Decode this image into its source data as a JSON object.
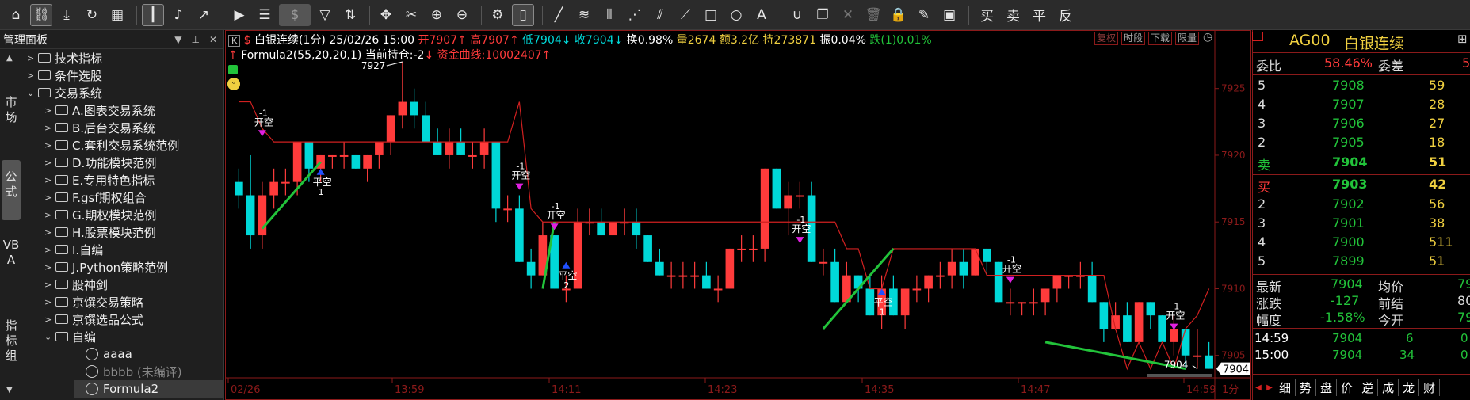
{
  "toolbar": {
    "trade_buy": "买",
    "trade_sell": "卖",
    "trade_flat": "平",
    "trade_reverse": "反",
    "icons": [
      "home-icon",
      "link-icon",
      "download-icon",
      "refresh-icon",
      "grid-icon",
      "candle-icon",
      "bell-icon",
      "chart-icon",
      "play-icon",
      "doc-icon",
      "money-icon",
      "filter-icon",
      "sort-icon",
      "move-icon",
      "cross-icon",
      "zoom-in-icon",
      "zoom-out-icon",
      "gear-icon",
      "mouse-icon",
      "line-icon",
      "fib-icon",
      "channel-icon",
      "fan-icon",
      "parallel-icon",
      "gann-icon",
      "rect-icon",
      "circle-icon",
      "text-icon",
      "magnet-icon",
      "copy-icon",
      "delete-icon",
      "trash-icon",
      "lock-icon",
      "pen-icon",
      "save-icon"
    ]
  },
  "sidebar": {
    "title": "管理面板",
    "vtabs": [
      "市场",
      "公式",
      "VBA",
      "指标组"
    ],
    "tree": [
      {
        "label": "技术指标",
        "level": 1,
        "type": "folder",
        "arrow": "›"
      },
      {
        "label": "条件选股",
        "level": 1,
        "type": "folder",
        "arrow": "›"
      },
      {
        "label": "交易系统",
        "level": 1,
        "type": "folder",
        "arrow": "⌄"
      },
      {
        "label": "A.图表交易系统",
        "level": 2,
        "type": "folder",
        "arrow": "›"
      },
      {
        "label": "B.后台交易系统",
        "level": 2,
        "type": "folder",
        "arrow": "›"
      },
      {
        "label": "C.套利交易系统范例",
        "level": 2,
        "type": "folder",
        "arrow": "›"
      },
      {
        "label": "D.功能模块范例",
        "level": 2,
        "type": "folder",
        "arrow": "›"
      },
      {
        "label": "E.专用特色指标",
        "level": 2,
        "type": "folder",
        "arrow": "›"
      },
      {
        "label": "F.gsf期权组合",
        "level": 2,
        "type": "folder",
        "arrow": "›"
      },
      {
        "label": "G.期权模块范例",
        "level": 2,
        "type": "folder",
        "arrow": "›"
      },
      {
        "label": "H.股票模块范例",
        "level": 2,
        "type": "folder",
        "arrow": "›"
      },
      {
        "label": "I.自编",
        "level": 2,
        "type": "folder",
        "arrow": "›"
      },
      {
        "label": "J.Python策略范例",
        "level": 2,
        "type": "folder",
        "arrow": "›"
      },
      {
        "label": "股神剑",
        "level": 2,
        "type": "folder",
        "arrow": "›"
      },
      {
        "label": "京馔交易策略",
        "level": 2,
        "type": "folder",
        "arrow": "›"
      },
      {
        "label": "京馔选品公式",
        "level": 2,
        "type": "folder",
        "arrow": "›"
      },
      {
        "label": "自编",
        "level": 2,
        "type": "folder",
        "arrow": "⌄"
      },
      {
        "label": "aaaa",
        "level": 3,
        "type": "formula",
        "arrow": ""
      },
      {
        "label": "bbbb (未编译)",
        "level": 3,
        "type": "formula",
        "arrow": "",
        "dim": true
      },
      {
        "label": "Formula2",
        "level": 3,
        "type": "formula",
        "arrow": "",
        "selected": true
      }
    ]
  },
  "chart": {
    "header": {
      "k_badge": "K",
      "s_badge": "$",
      "name": "白银连续(1分)",
      "datetime": "25/02/26 15:00",
      "open": "开7907",
      "high": "高7907",
      "low": "低7904",
      "close": "收7904",
      "turnover_rate": "换0.98%",
      "volume": "量2674",
      "amount": "额3.2亿",
      "open_interest": "持273871",
      "amplitude": "振0.04%",
      "change": "跌(1)0.01%",
      "btn_restore": "复权",
      "btn_time": "时段",
      "btn_download": "下载",
      "btn_limit": "限量"
    },
    "formula_line": {
      "name": "Formula2(55,20,20,1)",
      "position": "当前持仓:-2",
      "equity": "资金曲线:10002407"
    },
    "y_ticks": [
      "7925",
      "7920",
      "7915",
      "7910",
      "7905"
    ],
    "x_ticks": [
      "02/26",
      "13:59",
      "14:11",
      "14:23",
      "14:35",
      "14:47",
      "14:59"
    ],
    "period": "1分",
    "last_price_label": "7904",
    "high_label": "7927",
    "low_label": "7904",
    "signals": [
      {
        "n": "-1",
        "text": "开空"
      },
      {
        "n": "1",
        "text": "平空"
      },
      {
        "n": "-1",
        "text": "开空"
      },
      {
        "n": "-1",
        "text": "开空"
      },
      {
        "n": "2",
        "text": "平空"
      },
      {
        "n": "-1",
        "text": "开空"
      },
      {
        "n": "1",
        "text": "平空"
      },
      {
        "n": "-1",
        "text": "开空"
      },
      {
        "n": "-1",
        "text": "开空"
      }
    ]
  },
  "chart_data": {
    "type": "candlestick",
    "title": "白银连续(1分)",
    "ylim": [
      7903.5,
      7927
    ],
    "x_labels": [
      "02/26",
      "13:59",
      "14:11",
      "14:23",
      "14:35",
      "14:47",
      "14:59"
    ],
    "candles": [
      [
        7918,
        7919,
        7916,
        7917
      ],
      [
        7917,
        7920,
        7913,
        7914
      ],
      [
        7914,
        7918,
        7913,
        7917
      ],
      [
        7917,
        7919,
        7916,
        7918
      ],
      [
        7918,
        7919,
        7917,
        7918
      ],
      [
        7918,
        7921,
        7917,
        7921
      ],
      [
        7921,
        7921,
        7918,
        7919
      ],
      [
        7919,
        7920,
        7918,
        7920
      ],
      [
        7920,
        7920,
        7919,
        7920
      ],
      [
        7920,
        7921,
        7919,
        7920
      ],
      [
        7920,
        7920,
        7919,
        7919
      ],
      [
        7919,
        7920,
        7918,
        7920
      ],
      [
        7920,
        7921,
        7919,
        7921
      ],
      [
        7921,
        7923,
        7920,
        7923
      ],
      [
        7923,
        7927,
        7922,
        7924
      ],
      [
        7924,
        7925,
        7922,
        7923
      ],
      [
        7923,
        7924,
        7921,
        7921
      ],
      [
        7921,
        7922,
        7920,
        7920
      ],
      [
        7920,
        7922,
        7919,
        7921
      ],
      [
        7921,
        7922,
        7920,
        7920
      ],
      [
        7920,
        7921,
        7919,
        7920
      ],
      [
        7920,
        7922,
        7919,
        7921
      ],
      [
        7921,
        7921,
        7915,
        7916
      ],
      [
        7916,
        7917,
        7915,
        7916
      ],
      [
        7916,
        7917,
        7912,
        7912
      ],
      [
        7912,
        7913,
        7910,
        7911
      ],
      [
        7911,
        7915,
        7911,
        7914
      ],
      [
        7914,
        7914,
        7910,
        7910
      ],
      [
        7910,
        7911,
        7909,
        7910
      ],
      [
        7910,
        7916,
        7910,
        7915
      ],
      [
        7915,
        7916,
        7914,
        7915
      ],
      [
        7915,
        7916,
        7914,
        7914
      ],
      [
        7914,
        7915,
        7914,
        7915
      ],
      [
        7915,
        7916,
        7914,
        7915
      ],
      [
        7915,
        7916,
        7913,
        7914
      ],
      [
        7914,
        7914,
        7912,
        7912
      ],
      [
        7912,
        7913,
        7911,
        7911
      ],
      [
        7911,
        7912,
        7910,
        7911
      ],
      [
        7911,
        7912,
        7910,
        7911
      ],
      [
        7911,
        7912,
        7910,
        7911
      ],
      [
        7911,
        7912,
        7910,
        7910
      ],
      [
        7910,
        7911,
        7909,
        7910
      ],
      [
        7910,
        7913,
        7910,
        7913
      ],
      [
        7913,
        7914,
        7912,
        7913
      ],
      [
        7913,
        7914,
        7912,
        7913
      ],
      [
        7913,
        7919,
        7912,
        7919
      ],
      [
        7919,
        7919,
        7916,
        7916
      ],
      [
        7916,
        7918,
        7914,
        7917
      ],
      [
        7917,
        7918,
        7916,
        7917
      ],
      [
        7917,
        7918,
        7912,
        7912
      ],
      [
        7912,
        7913,
        7911,
        7912
      ],
      [
        7912,
        7913,
        7909,
        7909
      ],
      [
        7909,
        7912,
        7909,
        7911
      ],
      [
        7911,
        7911,
        7909,
        7910
      ],
      [
        7910,
        7911,
        7908,
        7908
      ],
      [
        7908,
        7911,
        7907,
        7910
      ],
      [
        7910,
        7911,
        7908,
        7908
      ],
      [
        7908,
        7910,
        7907,
        7910
      ],
      [
        7910,
        7911,
        7909,
        7910
      ],
      [
        7910,
        7911,
        7909,
        7911
      ],
      [
        7911,
        7912,
        7910,
        7911
      ],
      [
        7911,
        7913,
        7910,
        7912
      ],
      [
        7912,
        7913,
        7910,
        7911
      ],
      [
        7911,
        7913,
        7911,
        7913
      ],
      [
        7913,
        7913,
        7911,
        7912
      ],
      [
        7912,
        7912,
        7909,
        7909
      ],
      [
        7909,
        7910,
        7908,
        7909
      ],
      [
        7909,
        7909,
        7908,
        7909
      ],
      [
        7909,
        7910,
        7908,
        7909
      ],
      [
        7909,
        7910,
        7908,
        7910
      ],
      [
        7910,
        7911,
        7909,
        7911
      ],
      [
        7911,
        7911,
        7910,
        7911
      ],
      [
        7911,
        7912,
        7910,
        7911
      ],
      [
        7911,
        7912,
        7909,
        7909
      ],
      [
        7909,
        7909,
        7906,
        7907
      ],
      [
        7907,
        7909,
        7907,
        7908
      ],
      [
        7908,
        7909,
        7906,
        7906
      ],
      [
        7906,
        7909,
        7906,
        7909
      ],
      [
        7909,
        7909,
        7907,
        7908
      ],
      [
        7908,
        7908,
        7906,
        7906
      ],
      [
        7906,
        7908,
        7905,
        7907
      ],
      [
        7907,
        7907,
        7904,
        7905
      ],
      [
        7905,
        7907,
        7904,
        7905
      ],
      [
        7905,
        7906,
        7904,
        7904
      ]
    ]
  },
  "right_panel": {
    "code": "AG00",
    "name": "白银连续",
    "wb_label": "委比",
    "wb_value": "58.46%",
    "wc_label": "委差",
    "wc_value": "5",
    "asks": [
      {
        "level": "5",
        "price": "7908",
        "vol": "59"
      },
      {
        "level": "4",
        "price": "7907",
        "vol": "28"
      },
      {
        "level": "3",
        "price": "7906",
        "vol": "27"
      },
      {
        "level": "2",
        "price": "7905",
        "vol": "18"
      },
      {
        "level": "卖",
        "price": "7904",
        "vol": "51"
      }
    ],
    "bids": [
      {
        "level": "买",
        "price": "7903",
        "vol": "42"
      },
      {
        "level": "2",
        "price": "7902",
        "vol": "56"
      },
      {
        "level": "3",
        "price": "7901",
        "vol": "38"
      },
      {
        "level": "4",
        "price": "7900",
        "vol": "511"
      },
      {
        "level": "5",
        "price": "7899",
        "vol": "51"
      }
    ],
    "stats": [
      {
        "l1": "最新",
        "v1": "7904",
        "l2": "均价",
        "v2": "79"
      },
      {
        "l1": "涨跌",
        "v1": "-127",
        "l2": "前结",
        "v2": "80"
      },
      {
        "l1": "幅度",
        "v1": "-1.58%",
        "l2": "今开",
        "v2": "79"
      }
    ],
    "ticks": [
      {
        "time": "14:59",
        "price": "7904",
        "vol": "6",
        "flag": "0"
      },
      {
        "time": "15:00",
        "price": "7904",
        "vol": "34",
        "flag": "0"
      }
    ],
    "tabs": [
      "细",
      "势",
      "盘",
      "价",
      "逆",
      "成",
      "龙",
      "财"
    ]
  },
  "colors": {
    "up": "#ff3b3b",
    "down": "#00d8d8",
    "green": "#22c33a",
    "grid": "#8b1a1a",
    "yellow": "#f0d040"
  }
}
